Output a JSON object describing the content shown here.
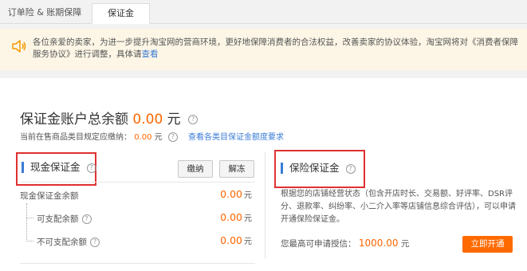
{
  "tabs": [
    {
      "label": "订单险 & 账期保障"
    },
    {
      "label": "保证金"
    }
  ],
  "notice": {
    "icon": "speaker-icon",
    "text": "各位亲爱的卖家，为进一步提升淘宝网的营商环境，更好地保障消费者的合法权益，改善卖家的协议体验，淘宝网将对《消费者保障服务协议》进行调整，具体请",
    "link": "查看"
  },
  "summary": {
    "title": "保证金账户总余额",
    "amount": "0.00",
    "unit": "元",
    "sub_prefix": "当前在售商品类目规定应缴纳：",
    "sub_amount": "0.00",
    "sub_unit": "元",
    "sub_link": "查看各类目保证金额度要求"
  },
  "cash": {
    "title": "现金保证金",
    "pay_button": "缴纳",
    "unfreeze_button": "解冻",
    "rows": [
      {
        "label": "现金保证金余额",
        "value": "0.00",
        "unit": "元"
      },
      {
        "label": "可支配余额",
        "value": "0.00",
        "unit": "元"
      },
      {
        "label": "不可支配余额",
        "value": "0.00",
        "unit": "元"
      }
    ]
  },
  "insurance": {
    "title": "保险保证金",
    "description": "根据您的店铺经营状态（包含开店时长、交易额、好评率、DSR评分、退款率、纠纷率、小二介入率等店铺信息综合评估），可以申请开通保险保证金。",
    "quota_label": "您最高可申请授信：",
    "quota_amount": "1000.00",
    "quota_unit": "元",
    "open_button": "立即开通"
  },
  "colors": {
    "accent": "#ff6600",
    "link": "#3a7bd5",
    "highlight_box": "#e03030"
  }
}
